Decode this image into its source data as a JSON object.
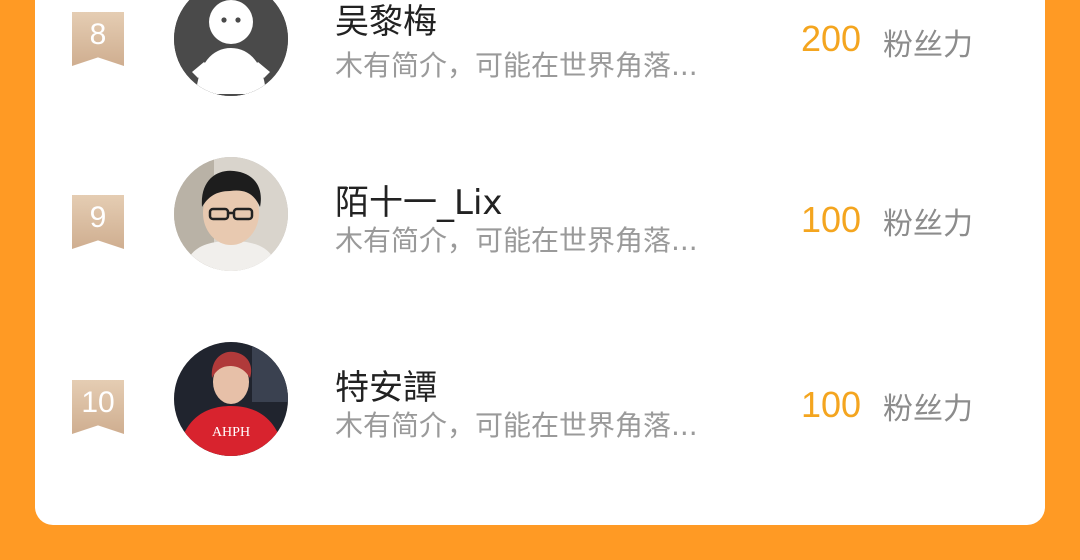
{
  "colors": {
    "page_background": "#ff9a24",
    "card_background": "#ffffff",
    "count_color": "#f4a51f",
    "rank_badge": "#d8b99b"
  },
  "ranking": {
    "items": [
      {
        "rank": "8",
        "name": "吴黎梅",
        "bio": "木有简介，可能在世界角落...",
        "count": "200",
        "unit": "粉丝力",
        "avatar_icon": "default-person-avatar"
      },
      {
        "rank": "9",
        "name": "陌十一_Lix",
        "bio": "木有简介，可能在世界角落...",
        "count": "100",
        "unit": "粉丝力",
        "avatar_icon": "photo-avatar-man-glasses"
      },
      {
        "rank": "10",
        "name": "特安譚",
        "bio": "木有简介，可能在世界角落...",
        "count": "100",
        "unit": "粉丝力",
        "avatar_icon": "photo-avatar-red-hoodie"
      }
    ]
  }
}
